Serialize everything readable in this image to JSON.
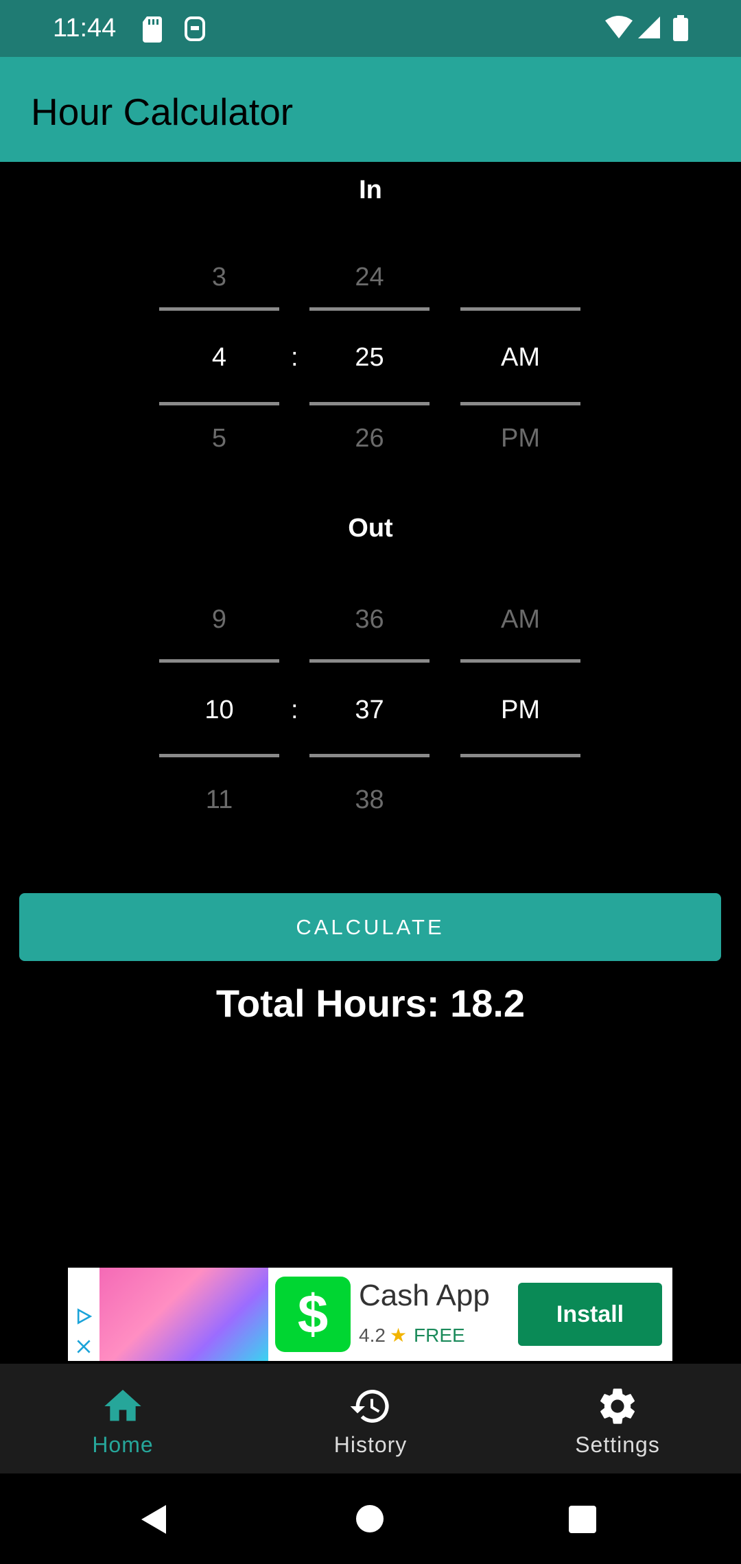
{
  "status_bar": {
    "time": "11:44"
  },
  "app_bar": {
    "title": "Hour Calculator"
  },
  "in_picker": {
    "label": "In",
    "hour": {
      "prev": "3",
      "selected": "4",
      "next": "5"
    },
    "separator": ":",
    "minute": {
      "prev": "24",
      "selected": "25",
      "next": "26"
    },
    "ampm": {
      "prev": "",
      "selected": "AM",
      "next": "PM"
    }
  },
  "out_picker": {
    "label": "Out",
    "hour": {
      "prev": "9",
      "selected": "10",
      "next": "11"
    },
    "separator": ":",
    "minute": {
      "prev": "36",
      "selected": "37",
      "next": "38"
    },
    "ampm": {
      "prev": "AM",
      "selected": "PM",
      "next": ""
    }
  },
  "calculate_button": {
    "label": "CALCULATE"
  },
  "result": {
    "text": "Total Hours: 18.2"
  },
  "ad": {
    "title": "Cash App",
    "rating": "4.2",
    "price": "FREE",
    "install_label": "Install"
  },
  "bottom_nav": {
    "items": [
      {
        "label": "Home",
        "icon": "home-icon",
        "active": true
      },
      {
        "label": "History",
        "icon": "history-icon",
        "active": false
      },
      {
        "label": "Settings",
        "icon": "settings-icon",
        "active": false
      }
    ]
  },
  "colors": {
    "status_bar": "#1f7b73",
    "primary": "#26a69a",
    "background": "#000000",
    "nav_background": "#1c1c1c"
  }
}
